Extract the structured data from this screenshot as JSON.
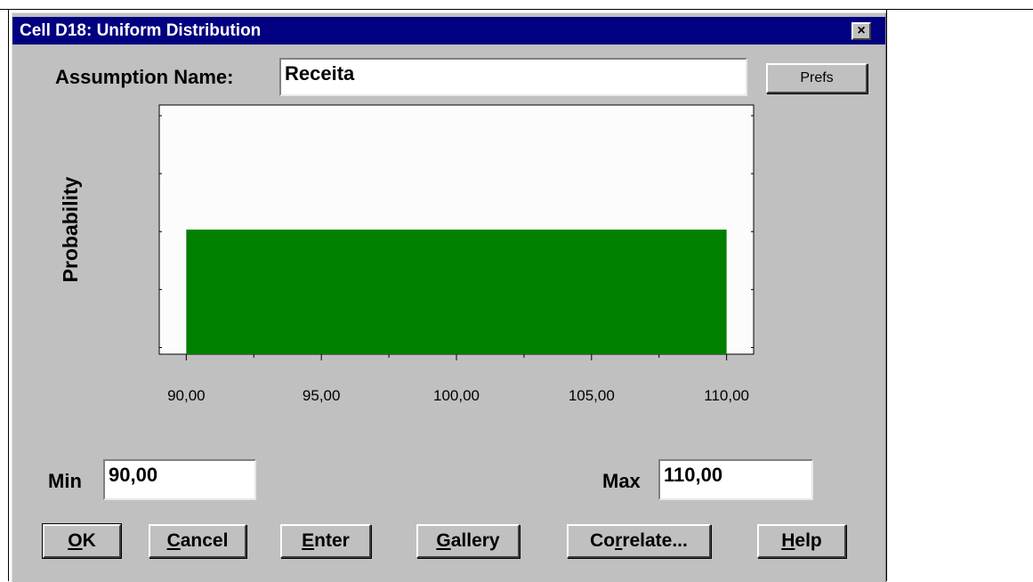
{
  "window": {
    "title": "Cell D18:  Uniform Distribution",
    "close_symbol": "×"
  },
  "assumption": {
    "label": "Assumption Name:",
    "value": "Receita"
  },
  "prefs_button": "Prefs",
  "chart_data": {
    "type": "bar",
    "distribution": "uniform",
    "ylabel": "Probability",
    "xlabel": "",
    "x_ticks": [
      "90,00",
      "95,00",
      "100,00",
      "105,00",
      "110,00"
    ],
    "x_tick_values": [
      90,
      95,
      100,
      105,
      110
    ],
    "xlim": [
      89,
      111
    ],
    "bar": {
      "x_start": 90,
      "x_end": 110,
      "relative_height": 0.5
    },
    "colors": {
      "bar": "#008000",
      "plot_bg": "#fcfcfc"
    }
  },
  "min": {
    "label": "Min",
    "value": "90,00"
  },
  "max": {
    "label": "Max",
    "value": "110,00"
  },
  "buttons": {
    "ok": {
      "underline": "O",
      "rest": "K"
    },
    "cancel": {
      "underline": "C",
      "rest": "ancel"
    },
    "enter": {
      "underline": "E",
      "rest": "nter"
    },
    "gallery": {
      "underline": "G",
      "rest": "allery"
    },
    "correlate": {
      "before": "Co",
      "underline": "r",
      "rest": "relate..."
    },
    "help": {
      "underline": "H",
      "rest": "elp"
    }
  }
}
